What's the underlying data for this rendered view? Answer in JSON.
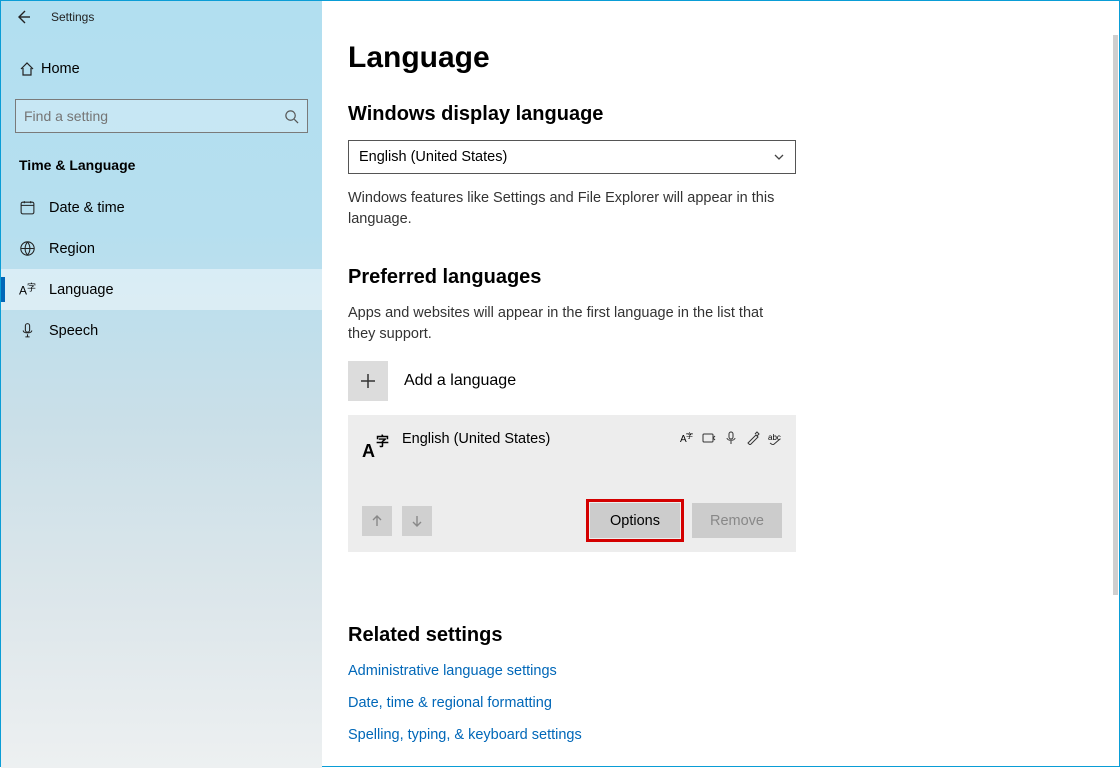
{
  "window": {
    "title": "Settings"
  },
  "sidebar": {
    "home": "Home",
    "search_placeholder": "Find a setting",
    "category": "Time & Language",
    "items": [
      {
        "label": "Date & time"
      },
      {
        "label": "Region"
      },
      {
        "label": "Language"
      },
      {
        "label": "Speech"
      }
    ]
  },
  "main": {
    "title": "Language",
    "display_heading": "Windows display language",
    "display_value": "English (United States)",
    "display_help": "Windows features like Settings and File Explorer will appear in this language.",
    "preferred_heading": "Preferred languages",
    "preferred_help": "Apps and websites will appear in the first language in the list that they support.",
    "add_language": "Add a language",
    "lang_item": {
      "name": "English (United States)",
      "options": "Options",
      "remove": "Remove"
    },
    "related_heading": "Related settings",
    "links": [
      "Administrative language settings",
      "Date, time & regional formatting",
      "Spelling, typing, & keyboard settings"
    ]
  }
}
